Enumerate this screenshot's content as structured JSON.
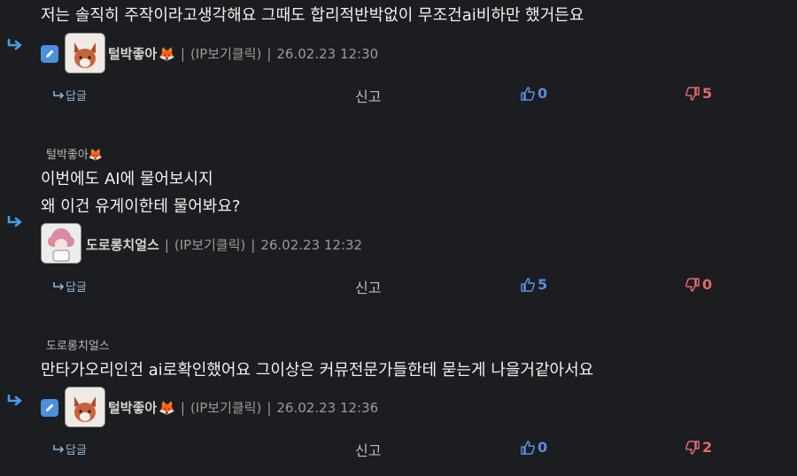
{
  "comments": [
    {
      "text_lines": [
        "저는 솔직히 주작이라고생각해요 그때도 합리적반박없이 무조건ai비하만 했거든요"
      ],
      "mention": "",
      "nickname": "털박좋아",
      "nick_emoji": "🦊",
      "ip_label": "(IP보기클릭)",
      "datetime": "26.02.23 12:30",
      "avatar": "fox-avatar",
      "edited": true,
      "reply_label": "답글",
      "report_label": "신고",
      "likes": "0",
      "dislikes": "5"
    },
    {
      "text_lines": [
        "이번에도 AI에 물어보시지",
        "왜 이건 유게이한테 물어봐요?"
      ],
      "mention": "털박좋아🦊",
      "nickname": "도로롱치얼스",
      "nick_emoji": "",
      "ip_label": "(IP보기클릭)",
      "datetime": "26.02.23 12:32",
      "avatar": "pink-hair-avatar",
      "edited": false,
      "reply_label": "답글",
      "report_label": "신고",
      "likes": "5",
      "dislikes": "0"
    },
    {
      "text_lines": [
        "만타가오리인건 ai로확인했어요 그이상은 커뮤전문가들한테 묻는게 나을거같아서요"
      ],
      "mention": "도로롱치얼스",
      "nickname": "털박좋아",
      "nick_emoji": "🦊",
      "ip_label": "(IP보기클릭)",
      "datetime": "26.02.23 12:36",
      "avatar": "fox-avatar",
      "edited": true,
      "reply_label": "답글",
      "report_label": "신고",
      "likes": "0",
      "dislikes": "2"
    }
  ],
  "colors": {
    "background": "#1c1d20",
    "like": "#5b8de0",
    "dislike": "#e06a6a",
    "reply_arrow": "#4a9be8",
    "edit_badge": "#4a8fe0"
  },
  "separator": "|"
}
